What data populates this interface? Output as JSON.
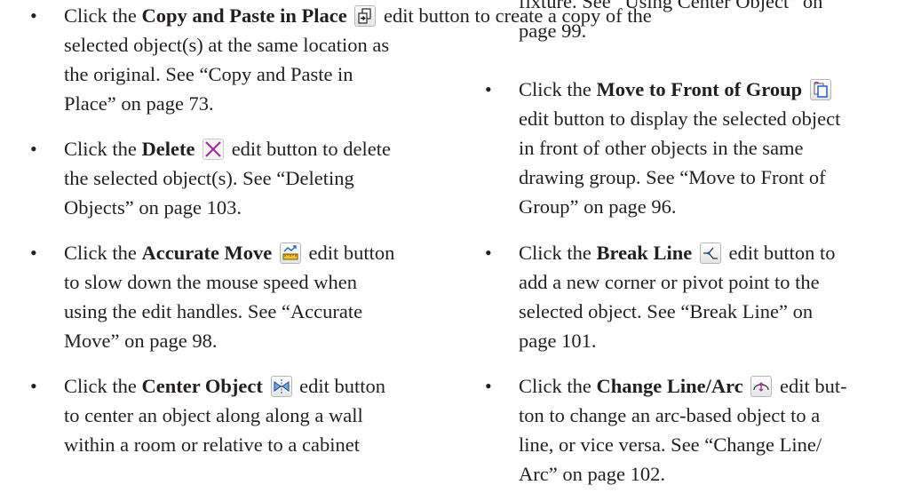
{
  "bullet_char": "•",
  "left_column": [
    {
      "pre": "Click the ",
      "bold": "Copy and Paste in Place",
      "icon": "copy-paste-in-place-icon",
      "post": " edit button to create a copy of the",
      "lines": [
        "selected object(s) at the same location as",
        "the original. See “Copy and Paste in",
        "Place” on page 73."
      ]
    },
    {
      "pre": "Click the ",
      "bold": "Delete",
      "icon": "delete-icon",
      "post": " edit button to delete",
      "lines": [
        "the selected object(s). See “Deleting",
        "Objects” on page 103."
      ]
    },
    {
      "pre": "Click the ",
      "bold": "Accurate Move",
      "icon": "accurate-move-icon",
      "post": " edit button",
      "lines": [
        "to slow down the mouse speed when",
        "using the edit handles. See “Accurate",
        "Move” on page 98."
      ]
    },
    {
      "pre": "Click the ",
      "bold": "Center Object",
      "icon": "center-object-icon",
      "post": " edit button",
      "lines": [
        "to center an object along along a wall",
        "within a room or relative to a cabinet"
      ]
    }
  ],
  "right_column": {
    "continuation": [
      "fixture. See “Using Center Object” on",
      "page 99."
    ],
    "items": [
      {
        "pre": "Click the ",
        "bold": "Move to Front of Group",
        "icon": "move-to-front-of-group-icon",
        "post": "",
        "lines": [
          "edit button to display the selected object",
          "in front of other objects in the same",
          "drawing group. See “Move to Front of",
          "Group” on page 96."
        ]
      },
      {
        "pre": "Click the ",
        "bold": "Break Line",
        "icon": "break-line-icon",
        "post": " edit button to",
        "lines": [
          "add a new corner or pivot point to the",
          "selected object. See “Break Line” on",
          "page 101."
        ]
      },
      {
        "pre": "Click the ",
        "bold": "Change Line/Arc",
        "icon": "change-line-arc-icon",
        "post": " edit but-",
        "lines": [
          "ton to change an arc-based object to a",
          "line, or vice versa. See “Change Line/",
          "Arc” on page 102."
        ]
      }
    ]
  }
}
